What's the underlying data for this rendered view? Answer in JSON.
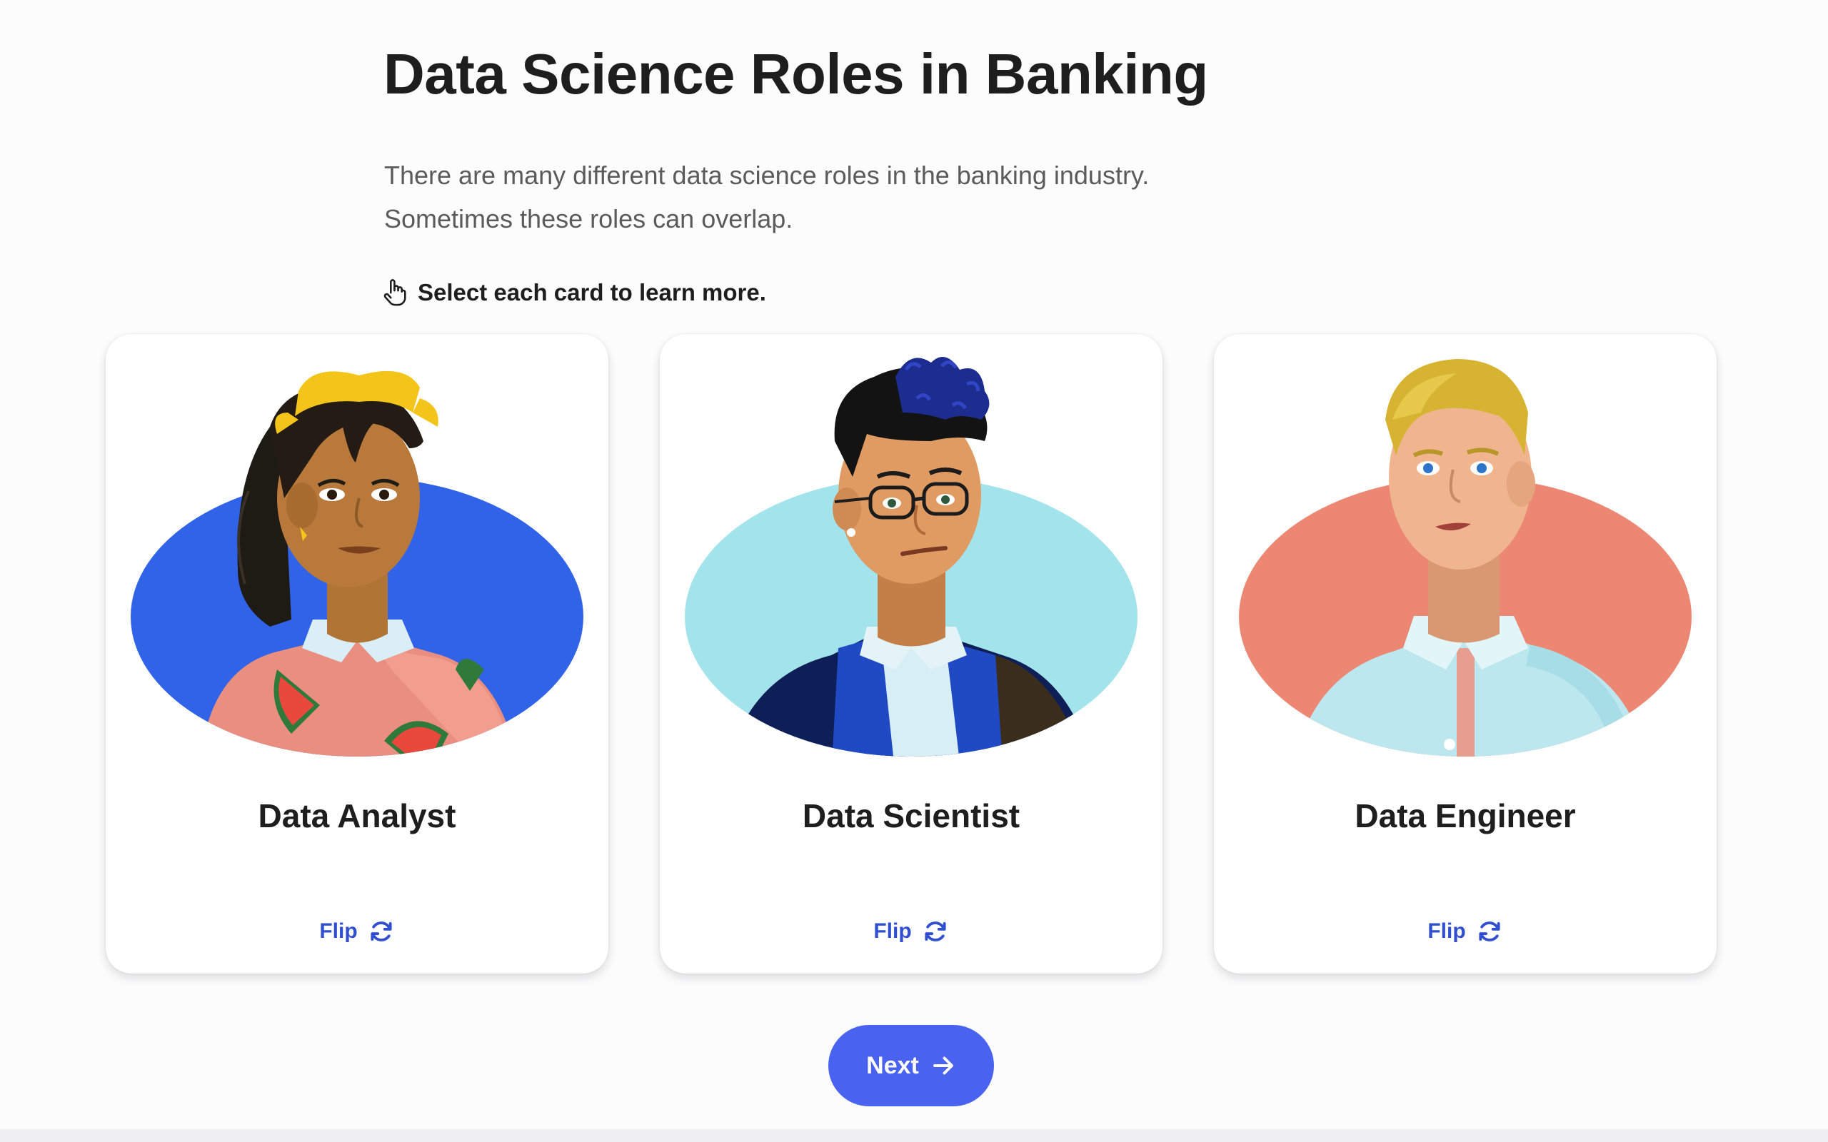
{
  "page": {
    "title": "Data Science Roles in Banking",
    "intro_lines": [
      "There are many different data science roles in the banking industry.",
      "Sometimes these roles can overlap."
    ],
    "instruction": "Select each card to learn more.",
    "instruction_icon": "pointing-hand-icon"
  },
  "cards": [
    {
      "name": "Data Analyst",
      "flip_label": "Flip",
      "background_color": "#3163e9",
      "flip_icon": "refresh-icon"
    },
    {
      "name": "Data Scientist",
      "flip_label": "Flip",
      "background_color": "#a3e4ec",
      "flip_icon": "refresh-icon"
    },
    {
      "name": "Data Engineer",
      "flip_label": "Flip",
      "background_color": "#ec8774",
      "flip_icon": "refresh-icon"
    }
  ],
  "next_button": {
    "label": "Next",
    "icon": "arrow-right-icon",
    "color": "#4a62f0"
  },
  "colors": {
    "accent": "#2f4fd0",
    "title": "#1e1e1e",
    "body_text": "#5b5b5b"
  }
}
